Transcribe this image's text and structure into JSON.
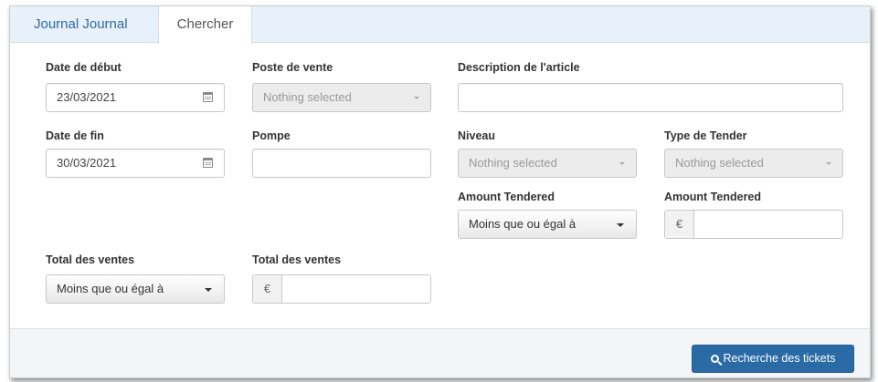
{
  "tabs": [
    {
      "label": "Journal Journal"
    },
    {
      "label": "Chercher"
    }
  ],
  "form": {
    "start_date": {
      "label": "Date de début",
      "value": "23/03/2021",
      "icon": "calendar-icon"
    },
    "end_date": {
      "label": "Date de fin",
      "value": "30/03/2021",
      "icon": "calendar-icon"
    },
    "point_of_sale": {
      "label": "Poste de vente",
      "value": "Nothing selected"
    },
    "pump": {
      "label": "Pompe",
      "value": ""
    },
    "item_description": {
      "label": "Description de l'article",
      "value": ""
    },
    "level": {
      "label": "Niveau",
      "value": "Nothing selected"
    },
    "tender_type": {
      "label": "Type de Tender",
      "value": "Nothing selected"
    },
    "amount_tendered_operator": {
      "label": "Amount Tendered",
      "value": "Moins que ou égal à"
    },
    "amount_tendered_value": {
      "label": "Amount Tendered",
      "currency": "€",
      "value": ""
    },
    "sales_total_operator": {
      "label": "Total des ventes",
      "value": "Moins que ou égal à"
    },
    "sales_total_value": {
      "label": "Total des ventes",
      "currency": "€",
      "value": ""
    }
  },
  "footer": {
    "search_button": "Recherche des tickets",
    "search_icon": "search-icon",
    "button_color": "#2a6aa5"
  }
}
